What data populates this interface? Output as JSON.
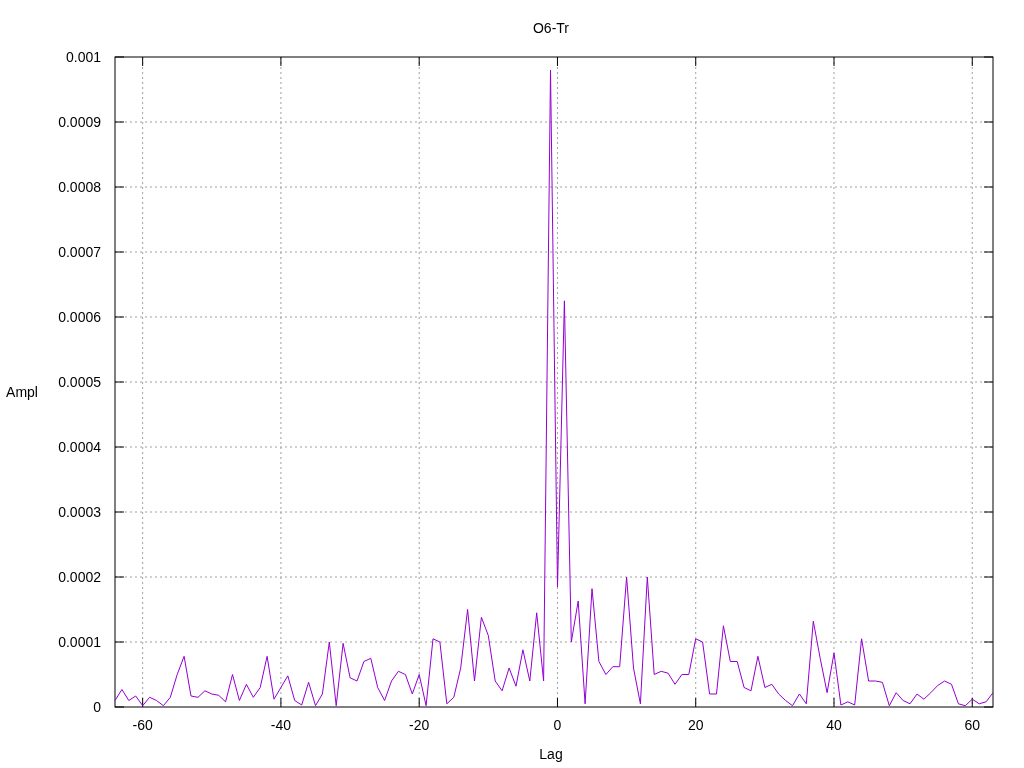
{
  "chart_data": {
    "type": "line",
    "title": "O6-Tr",
    "xlabel": "Lag",
    "ylabel": "Ampl",
    "grid": true,
    "xlim": [
      -64,
      63
    ],
    "ylim": [
      0,
      0.001
    ],
    "xticks": [
      -60,
      -40,
      -20,
      0,
      20,
      40,
      60
    ],
    "yticks": [
      {
        "value": 0,
        "label": "0"
      },
      {
        "value": 0.0001,
        "label": "0.0001"
      },
      {
        "value": 0.0002,
        "label": "0.0002"
      },
      {
        "value": 0.0003,
        "label": "0.0003"
      },
      {
        "value": 0.0004,
        "label": "0.0004"
      },
      {
        "value": 0.0005,
        "label": "0.0005"
      },
      {
        "value": 0.0006,
        "label": "0.0006"
      },
      {
        "value": 0.0007,
        "label": "0.0007"
      },
      {
        "value": 0.0008,
        "label": "0.0008"
      },
      {
        "value": 0.0009,
        "label": "0.0009"
      },
      {
        "value": 0.001,
        "label": "0.001"
      }
    ],
    "x": [
      -64,
      -63,
      -62,
      -61,
      -60,
      -59,
      -58,
      -57,
      -56,
      -55,
      -54,
      -53,
      -52,
      -51,
      -50,
      -49,
      -48,
      -47,
      -46,
      -45,
      -44,
      -43,
      -42,
      -41,
      -40,
      -39,
      -38,
      -37,
      -36,
      -35,
      -34,
      -33,
      -32,
      -31,
      -30,
      -29,
      -28,
      -27,
      -26,
      -25,
      -24,
      -23,
      -22,
      -21,
      -20,
      -19,
      -18,
      -17,
      -16,
      -15,
      -14,
      -13,
      -12,
      -11,
      -10,
      -9,
      -8,
      -7,
      -6,
      -5,
      -4,
      -3,
      -2,
      -1,
      0,
      1,
      2,
      3,
      4,
      5,
      6,
      7,
      8,
      9,
      10,
      11,
      12,
      13,
      14,
      15,
      16,
      17,
      18,
      19,
      20,
      21,
      22,
      23,
      24,
      25,
      26,
      27,
      28,
      29,
      30,
      31,
      32,
      33,
      34,
      35,
      36,
      37,
      38,
      39,
      40,
      41,
      42,
      43,
      44,
      45,
      46,
      47,
      48,
      49,
      50,
      51,
      52,
      53,
      54,
      55,
      56,
      57,
      58,
      59,
      60,
      61,
      62,
      63
    ],
    "series": [
      {
        "color": "#9400d3",
        "values": [
          1e-05,
          2.7e-05,
          1e-05,
          1.7e-05,
          2e-06,
          1.5e-05,
          1e-05,
          2e-06,
          1.5e-05,
          5e-05,
          7.8e-05,
          1.7e-05,
          1.5e-05,
          2.5e-05,
          2e-05,
          1.8e-05,
          8e-06,
          5e-05,
          1e-05,
          3.5e-05,
          1.5e-05,
          3e-05,
          7.8e-05,
          1.2e-05,
          3e-05,
          4.8e-05,
          1e-05,
          3e-06,
          3.8e-05,
          2e-06,
          2e-05,
          0.0001,
          2e-06,
          9.8e-05,
          4.5e-05,
          4e-05,
          7e-05,
          7.5e-05,
          3e-05,
          1e-05,
          4e-05,
          5.5e-05,
          5e-05,
          2e-05,
          5e-05,
          2e-06,
          0.000105,
          0.0001,
          5e-06,
          1.5e-05,
          6e-05,
          0.00015,
          4e-05,
          0.000138,
          0.00011,
          4e-05,
          2.5e-05,
          6e-05,
          3.2e-05,
          8.8e-05,
          4e-05,
          0.000145,
          4e-05,
          0.00098,
          0.000185,
          0.000625,
          0.0001,
          0.000163,
          5e-06,
          0.000182,
          7e-05,
          5e-05,
          6.2e-05,
          6.2e-05,
          0.0002,
          6e-05,
          5e-06,
          0.0002,
          5e-05,
          5.5e-05,
          5.2e-05,
          3.5e-05,
          5e-05,
          5e-05,
          0.000105,
          0.0001,
          2e-05,
          2e-05,
          0.000125,
          7e-05,
          7e-05,
          3e-05,
          2.5e-05,
          7.8e-05,
          3e-05,
          3.5e-05,
          2e-05,
          1e-05,
          2e-06,
          2e-05,
          5e-06,
          0.000132,
          7.5e-05,
          2.2e-05,
          8.3e-05,
          3e-06,
          8e-06,
          3e-06,
          0.000105,
          4e-05,
          4e-05,
          3.8e-05,
          2e-06,
          2.2e-05,
          1e-05,
          5e-06,
          2e-05,
          1.2e-05,
          2.2e-05,
          3.3e-05,
          4e-05,
          3.5e-05,
          5e-06,
          2e-06,
          1.2e-05,
          5e-06,
          8e-06,
          2.2e-05
        ]
      }
    ]
  }
}
